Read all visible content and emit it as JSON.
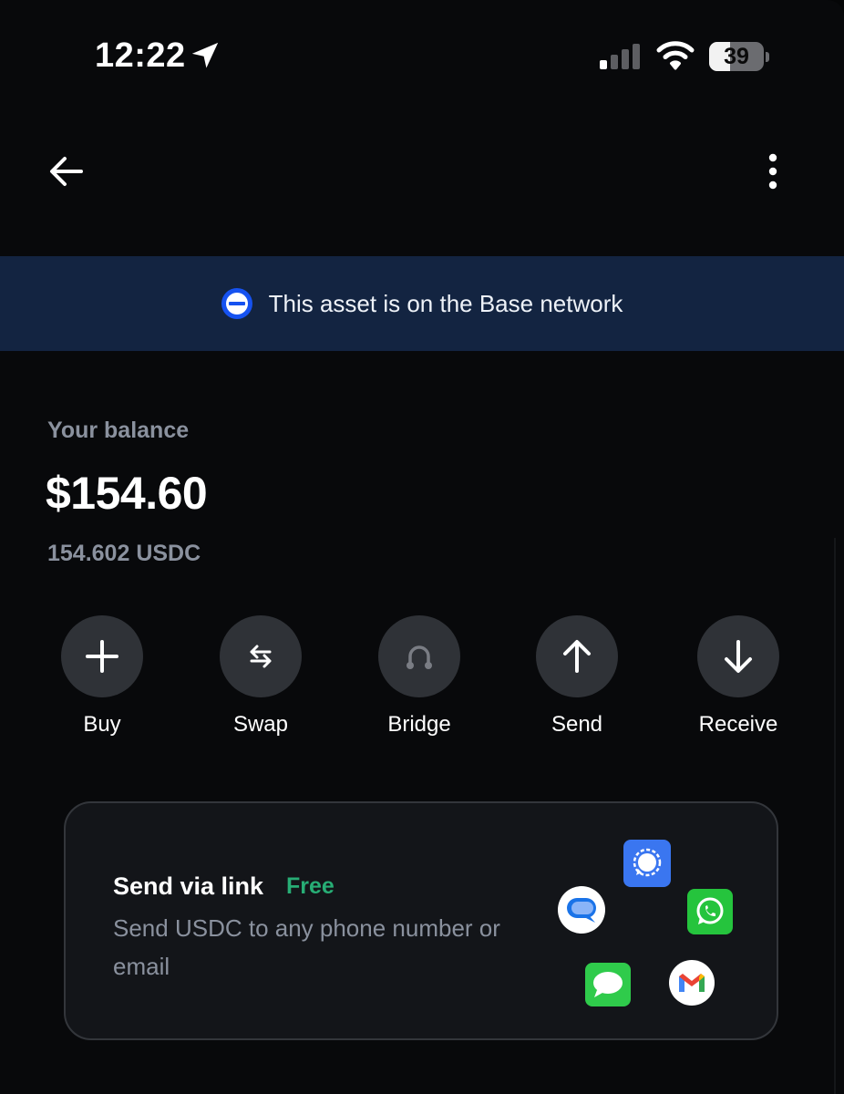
{
  "status_bar": {
    "time": "12:22",
    "battery_percent": 39,
    "battery_label": "39",
    "location_icon": "location-arrow-icon",
    "signal_icon": "cellular-signal-icon",
    "wifi_icon": "wifi-icon"
  },
  "nav": {
    "back_icon": "arrow-left-icon",
    "more_icon": "more-vertical-icon"
  },
  "banner": {
    "icon": "base-network-icon",
    "text": "This asset is on the Base network",
    "background": "#132441"
  },
  "balance": {
    "label": "Your balance",
    "fiat": "$154.60",
    "token": "154.602 USDC"
  },
  "actions": [
    {
      "label": "Buy",
      "icon": "plus-icon",
      "enabled": true
    },
    {
      "label": "Swap",
      "icon": "swap-icon",
      "enabled": true
    },
    {
      "label": "Bridge",
      "icon": "bridge-icon",
      "enabled": false
    },
    {
      "label": "Send",
      "icon": "arrow-up-icon",
      "enabled": true
    },
    {
      "label": "Receive",
      "icon": "arrow-down-icon",
      "enabled": true
    }
  ],
  "send_link_card": {
    "title": "Send via link",
    "badge": "Free",
    "badge_color": "#27ad75",
    "description": "Send USDC to any phone number or email",
    "app_icons": [
      "signal-app-icon",
      "google-messages-icon",
      "whatsapp-icon",
      "imessage-icon",
      "gmail-icon"
    ]
  }
}
